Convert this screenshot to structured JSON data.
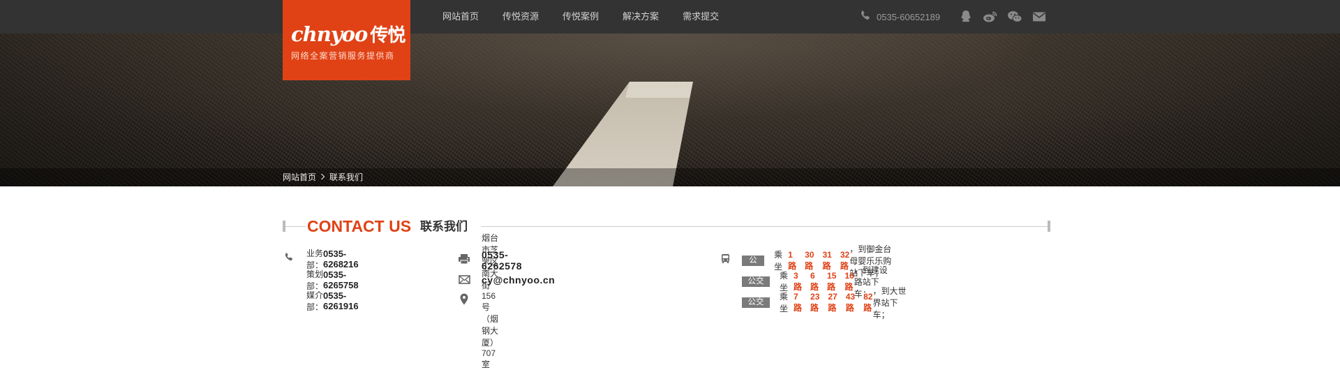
{
  "logo": {
    "brand_en": "chnyoo",
    "brand_cn": "传悦",
    "tagline": "网络全案营销服务提供商"
  },
  "nav": {
    "items": [
      "网站首页",
      "传悦资源",
      "传悦案例",
      "解决方案",
      "需求提交"
    ]
  },
  "header": {
    "phone": "0535-60652189",
    "social_icons": [
      "qq-icon",
      "weibo-icon",
      "wechat-icon",
      "mail-icon"
    ]
  },
  "breadcrumb": {
    "home": "网站首页",
    "current": "联系我们"
  },
  "section": {
    "title_en": "CONTACT US",
    "title_zh": "联系我们"
  },
  "departments": [
    {
      "label": "业务部：",
      "phone": "0535-6268216"
    },
    {
      "label": "策划部：",
      "phone": "0535-6265758"
    },
    {
      "label": "媒介部：",
      "phone": "0535-6261916"
    }
  ],
  "contact": {
    "fax": "0535-6262578",
    "email": "cy@chnyoo.cn",
    "address": "烟台市芝罘区南大街156号（烟钢大厦）707室"
  },
  "bus_routes": [
    {
      "name": "公交线路1",
      "ride": "乘坐",
      "buses": [
        "1路",
        "30路",
        "31路",
        "32路"
      ],
      "dest": "，到御金台母婴乐乐购站下车；"
    },
    {
      "name": "公交线路2",
      "ride": "乘坐",
      "buses": [
        "3路",
        "6路",
        "15路",
        "16路"
      ],
      "dest": "，到建设路站下车；"
    },
    {
      "name": "公交线路3",
      "ride": "乘坐",
      "buses": [
        "7路",
        "23路",
        "27路",
        "43路",
        "82路"
      ],
      "dest": "，到大世界站下车；"
    }
  ],
  "colors": {
    "accent": "#e04216",
    "topbar": "#333333",
    "badge": "#7a7a7a"
  }
}
